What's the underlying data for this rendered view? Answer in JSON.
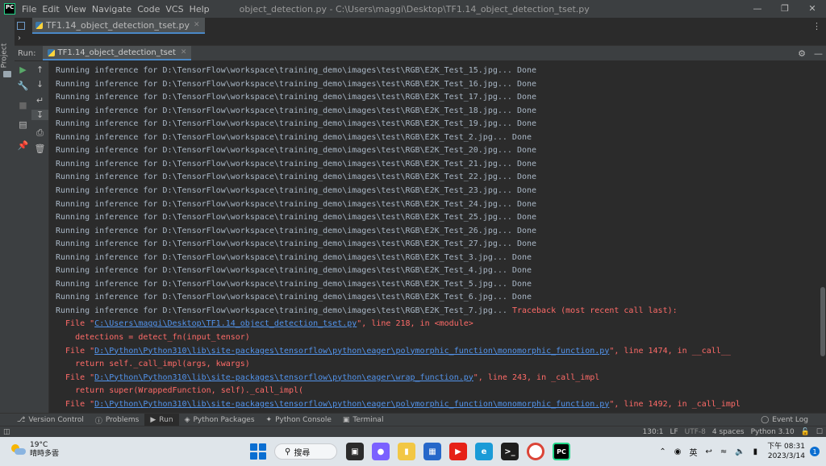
{
  "app": {
    "menu": [
      "File",
      "Edit",
      "View",
      "Navigate",
      "Code",
      "VCS",
      "Help"
    ],
    "window_title": "object_detection.py - C:\\Users\\maggi\\Desktop\\TF1.14_object_detection_tset.py",
    "project_label": "Project"
  },
  "editor": {
    "tab_label": "TF1.14_object_detection_tset.py"
  },
  "run_panel": {
    "label": "Run:",
    "tab_label": "TF1.14_object_detection_tset"
  },
  "console": {
    "lines": [
      {
        "text": "Running inference for D:\\TensorFlow\\workspace\\training_demo\\images\\test\\RGB\\E2K_Test_15.jpg... Done"
      },
      {
        "text": "Running inference for D:\\TensorFlow\\workspace\\training_demo\\images\\test\\RGB\\E2K_Test_16.jpg... Done"
      },
      {
        "text": "Running inference for D:\\TensorFlow\\workspace\\training_demo\\images\\test\\RGB\\E2K_Test_17.jpg... Done"
      },
      {
        "text": "Running inference for D:\\TensorFlow\\workspace\\training_demo\\images\\test\\RGB\\E2K_Test_18.jpg... Done"
      },
      {
        "text": "Running inference for D:\\TensorFlow\\workspace\\training_demo\\images\\test\\RGB\\E2K_Test_19.jpg... Done"
      },
      {
        "text": "Running inference for D:\\TensorFlow\\workspace\\training_demo\\images\\test\\RGB\\E2K_Test_2.jpg... Done"
      },
      {
        "text": "Running inference for D:\\TensorFlow\\workspace\\training_demo\\images\\test\\RGB\\E2K_Test_20.jpg... Done"
      },
      {
        "text": "Running inference for D:\\TensorFlow\\workspace\\training_demo\\images\\test\\RGB\\E2K_Test_21.jpg... Done"
      },
      {
        "text": "Running inference for D:\\TensorFlow\\workspace\\training_demo\\images\\test\\RGB\\E2K_Test_22.jpg... Done"
      },
      {
        "text": "Running inference for D:\\TensorFlow\\workspace\\training_demo\\images\\test\\RGB\\E2K_Test_23.jpg... Done"
      },
      {
        "text": "Running inference for D:\\TensorFlow\\workspace\\training_demo\\images\\test\\RGB\\E2K_Test_24.jpg... Done"
      },
      {
        "text": "Running inference for D:\\TensorFlow\\workspace\\training_demo\\images\\test\\RGB\\E2K_Test_25.jpg... Done"
      },
      {
        "text": "Running inference for D:\\TensorFlow\\workspace\\training_demo\\images\\test\\RGB\\E2K_Test_26.jpg... Done"
      },
      {
        "text": "Running inference for D:\\TensorFlow\\workspace\\training_demo\\images\\test\\RGB\\E2K_Test_27.jpg... Done"
      },
      {
        "text": "Running inference for D:\\TensorFlow\\workspace\\training_demo\\images\\test\\RGB\\E2K_Test_3.jpg... Done"
      },
      {
        "text": "Running inference for D:\\TensorFlow\\workspace\\training_demo\\images\\test\\RGB\\E2K_Test_4.jpg... Done"
      },
      {
        "text": "Running inference for D:\\TensorFlow\\workspace\\training_demo\\images\\test\\RGB\\E2K_Test_5.jpg... Done"
      },
      {
        "text": "Running inference for D:\\TensorFlow\\workspace\\training_demo\\images\\test\\RGB\\E2K_Test_6.jpg... Done"
      },
      {
        "text": "Running inference for D:\\TensorFlow\\workspace\\training_demo\\images\\test\\RGB\\E2K_Test_7.jpg... ",
        "err": "Traceback (most recent call last):"
      },
      {
        "err_pre": "  File \"",
        "link": "C:\\Users\\maggi\\Desktop\\TF1.14_object_detection_tset.py",
        "err_post": "\", line 218, in <module>"
      },
      {
        "err_pre": "    detections = detect_fn(input_tensor)"
      },
      {
        "err_pre": "  File \"",
        "link": "D:\\Python\\Python310\\lib\\site-packages\\tensorflow\\python\\eager\\polymorphic_function\\monomorphic_function.py",
        "err_post": "\", line 1474, in __call__"
      },
      {
        "err_pre": "    return self._call_impl(args, kwargs)"
      },
      {
        "err_pre": "  File \"",
        "link": "D:\\Python\\Python310\\lib\\site-packages\\tensorflow\\python\\eager\\wrap_function.py",
        "err_post": "\", line 243, in _call_impl"
      },
      {
        "err_pre": "    return super(WrappedFunction, self)._call_impl("
      },
      {
        "err_pre": "  File \"",
        "link": "D:\\Python\\Python310\\lib\\site-packages\\tensorflow\\python\\eager\\polymorphic_function\\monomorphic_function.py",
        "err_post": "\", line 1492, in _call_impl"
      }
    ]
  },
  "bottom_tabs": [
    {
      "icon": "version-control-icon",
      "label": "Version Control"
    },
    {
      "icon": "problems-icon",
      "label": "Problems"
    },
    {
      "icon": "run-icon",
      "label": "Run",
      "active": true
    },
    {
      "icon": "python-packages-icon",
      "label": "Python Packages"
    },
    {
      "icon": "python-console-icon",
      "label": "Python Console"
    },
    {
      "icon": "terminal-icon",
      "label": "Terminal"
    }
  ],
  "event_log": "Event Log",
  "status": {
    "position": "130:1",
    "line_sep": "LF",
    "encoding": "UTF-8",
    "indent": "4 spaces",
    "interpreter": "Python 3.10"
  },
  "taskbar": {
    "temperature": "19°C",
    "weather_desc": "晴時多雲",
    "search_label": "搜尋",
    "ime": "英",
    "time": "下午 08:31",
    "date": "2023/3/14",
    "notification_count": "1"
  },
  "colors": {
    "console_text": "#a9b7c6",
    "error_text": "#ff6b68",
    "link": "#5394ec",
    "accent": "#4a88c7"
  }
}
